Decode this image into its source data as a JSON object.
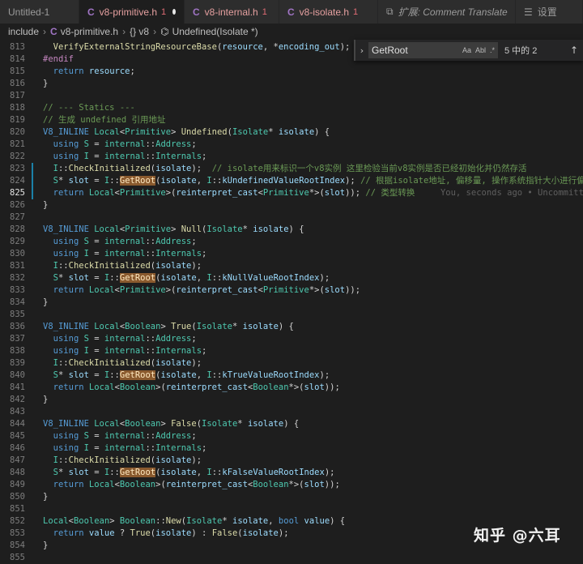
{
  "tabs": [
    {
      "label": "Untitled-1",
      "icon": "file-icon",
      "badge": "",
      "active": false
    },
    {
      "label": "v8-primitive.h",
      "icon": "c-file-icon",
      "badge": "1",
      "active": true,
      "dirty": true
    },
    {
      "label": "v8-internal.h",
      "icon": "c-file-icon",
      "badge": "1",
      "active": false
    },
    {
      "label": "v8-isolate.h",
      "icon": "c-file-icon",
      "badge": "1",
      "active": false
    },
    {
      "label": "扩展: Comment Translate",
      "icon": "extension-icon",
      "badge": "",
      "active": false
    },
    {
      "label": "设置",
      "icon": "settings-icon",
      "badge": "",
      "active": false
    }
  ],
  "tab_icon_glyphs": {
    "c": "C"
  },
  "breadcrumb": {
    "folder": "include",
    "file": "v8-primitive.h",
    "namespace": "{} v8",
    "symbol": "Undefined(Isolate *)"
  },
  "find": {
    "query": "GetRoot",
    "opt_case": "Aa",
    "opt_word": "Abl",
    "opt_regex": ".*",
    "count": "5 中的 2",
    "toggle_glyph": "›",
    "up_glyph": "↑"
  },
  "current_line": "825",
  "blame": "You, seconds ago • Uncommitted c",
  "lines": [
    {
      "n": "813",
      "code": "  VerifyExternalStringResourceBase(resource, *encoding_out);"
    },
    {
      "n": "814",
      "code": "#endif"
    },
    {
      "n": "815",
      "code": "  return resource;"
    },
    {
      "n": "816",
      "code": "}"
    },
    {
      "n": "817",
      "code": ""
    },
    {
      "n": "818",
      "code": "// --- Statics ---"
    },
    {
      "n": "819",
      "code": "// 生成 undefined 引用地址"
    },
    {
      "n": "820",
      "code": "V8_INLINE Local<Primitive> Undefined(Isolate* isolate) {"
    },
    {
      "n": "821",
      "code": "  using S = internal::Address;"
    },
    {
      "n": "822",
      "code": "  using I = internal::Internals;"
    },
    {
      "n": "823",
      "code": "  I::CheckInitialized(isolate);  // isolate用来标识一个v8实例 这里检验当前v8实例是否已经初始化并仍然存活"
    },
    {
      "n": "824",
      "code": "  S* slot = I::GetRoot(isolate, I::kUndefinedValueRootIndex); // 根据isolate地址, 偏移量, 操作系统指针大小进行偏移"
    },
    {
      "n": "825",
      "code": "  return Local<Primitive>(reinterpret_cast<Primitive*>(slot)); // 类型转换"
    },
    {
      "n": "826",
      "code": "}"
    },
    {
      "n": "827",
      "code": ""
    },
    {
      "n": "828",
      "code": "V8_INLINE Local<Primitive> Null(Isolate* isolate) {"
    },
    {
      "n": "829",
      "code": "  using S = internal::Address;"
    },
    {
      "n": "830",
      "code": "  using I = internal::Internals;"
    },
    {
      "n": "831",
      "code": "  I::CheckInitialized(isolate);"
    },
    {
      "n": "832",
      "code": "  S* slot = I::GetRoot(isolate, I::kNullValueRootIndex);"
    },
    {
      "n": "833",
      "code": "  return Local<Primitive>(reinterpret_cast<Primitive*>(slot));"
    },
    {
      "n": "834",
      "code": "}"
    },
    {
      "n": "835",
      "code": ""
    },
    {
      "n": "836",
      "code": "V8_INLINE Local<Boolean> True(Isolate* isolate) {"
    },
    {
      "n": "837",
      "code": "  using S = internal::Address;"
    },
    {
      "n": "838",
      "code": "  using I = internal::Internals;"
    },
    {
      "n": "839",
      "code": "  I::CheckInitialized(isolate);"
    },
    {
      "n": "840",
      "code": "  S* slot = I::GetRoot(isolate, I::kTrueValueRootIndex);"
    },
    {
      "n": "841",
      "code": "  return Local<Boolean>(reinterpret_cast<Boolean*>(slot));"
    },
    {
      "n": "842",
      "code": "}"
    },
    {
      "n": "843",
      "code": ""
    },
    {
      "n": "844",
      "code": "V8_INLINE Local<Boolean> False(Isolate* isolate) {"
    },
    {
      "n": "845",
      "code": "  using S = internal::Address;"
    },
    {
      "n": "846",
      "code": "  using I = internal::Internals;"
    },
    {
      "n": "847",
      "code": "  I::CheckInitialized(isolate);"
    },
    {
      "n": "848",
      "code": "  S* slot = I::GetRoot(isolate, I::kFalseValueRootIndex);"
    },
    {
      "n": "849",
      "code": "  return Local<Boolean>(reinterpret_cast<Boolean*>(slot));"
    },
    {
      "n": "850",
      "code": "}"
    },
    {
      "n": "851",
      "code": ""
    },
    {
      "n": "852",
      "code": "Local<Boolean> Boolean::New(Isolate* isolate, bool value) {"
    },
    {
      "n": "853",
      "code": "  return value ? True(isolate) : False(isolate);"
    },
    {
      "n": "854",
      "code": "}"
    },
    {
      "n": "855",
      "code": ""
    }
  ],
  "watermark": "知乎 @六耳",
  "colors": {
    "background": "#1e1e1e",
    "keyword": "#569cd6",
    "type": "#4ec9b0",
    "function": "#dcdcaa",
    "param": "#9cdcfe",
    "comment": "#6a9955",
    "preprocessor": "#c586c0",
    "find_highlight": "#8a5a2e",
    "modified_gutter": "#1b81a8"
  }
}
